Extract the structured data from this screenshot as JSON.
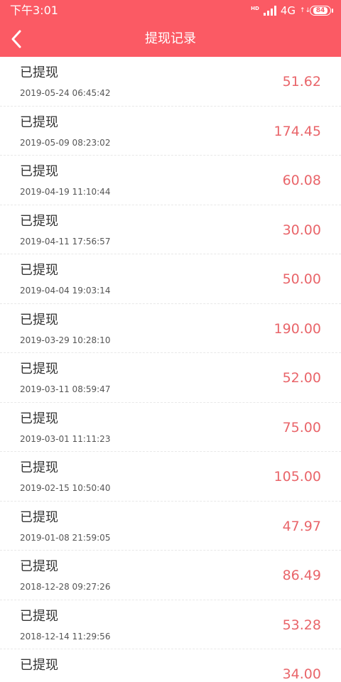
{
  "status_bar": {
    "time": "下午3:01",
    "signal_label": "HD",
    "network": "4G",
    "arrows": "↑↓",
    "battery": "84"
  },
  "nav": {
    "title": "提现记录"
  },
  "records": [
    {
      "status": "已提现",
      "time": "2019-05-24 06:45:42",
      "amount": "51.62"
    },
    {
      "status": "已提现",
      "time": "2019-05-09 08:23:02",
      "amount": "174.45"
    },
    {
      "status": "已提现",
      "time": "2019-04-19 11:10:44",
      "amount": "60.08"
    },
    {
      "status": "已提现",
      "time": "2019-04-11 17:56:57",
      "amount": "30.00"
    },
    {
      "status": "已提现",
      "time": "2019-04-04 19:03:14",
      "amount": "50.00"
    },
    {
      "status": "已提现",
      "time": "2019-03-29 10:28:10",
      "amount": "190.00"
    },
    {
      "status": "已提现",
      "time": "2019-03-11 08:59:47",
      "amount": "52.00"
    },
    {
      "status": "已提现",
      "time": "2019-03-01 11:11:23",
      "amount": "75.00"
    },
    {
      "status": "已提现",
      "time": "2019-02-15 10:50:40",
      "amount": "105.00"
    },
    {
      "status": "已提现",
      "time": "2019-01-08 21:59:05",
      "amount": "47.97"
    },
    {
      "status": "已提现",
      "time": "2018-12-28 09:27:26",
      "amount": "86.49"
    },
    {
      "status": "已提现",
      "time": "2018-12-14 11:29:56",
      "amount": "53.28"
    },
    {
      "status": "已提现",
      "time": "",
      "amount": "34.00"
    }
  ],
  "colors": {
    "header": "#fb5a64",
    "amount": "#e9656a",
    "text": "#333333"
  }
}
